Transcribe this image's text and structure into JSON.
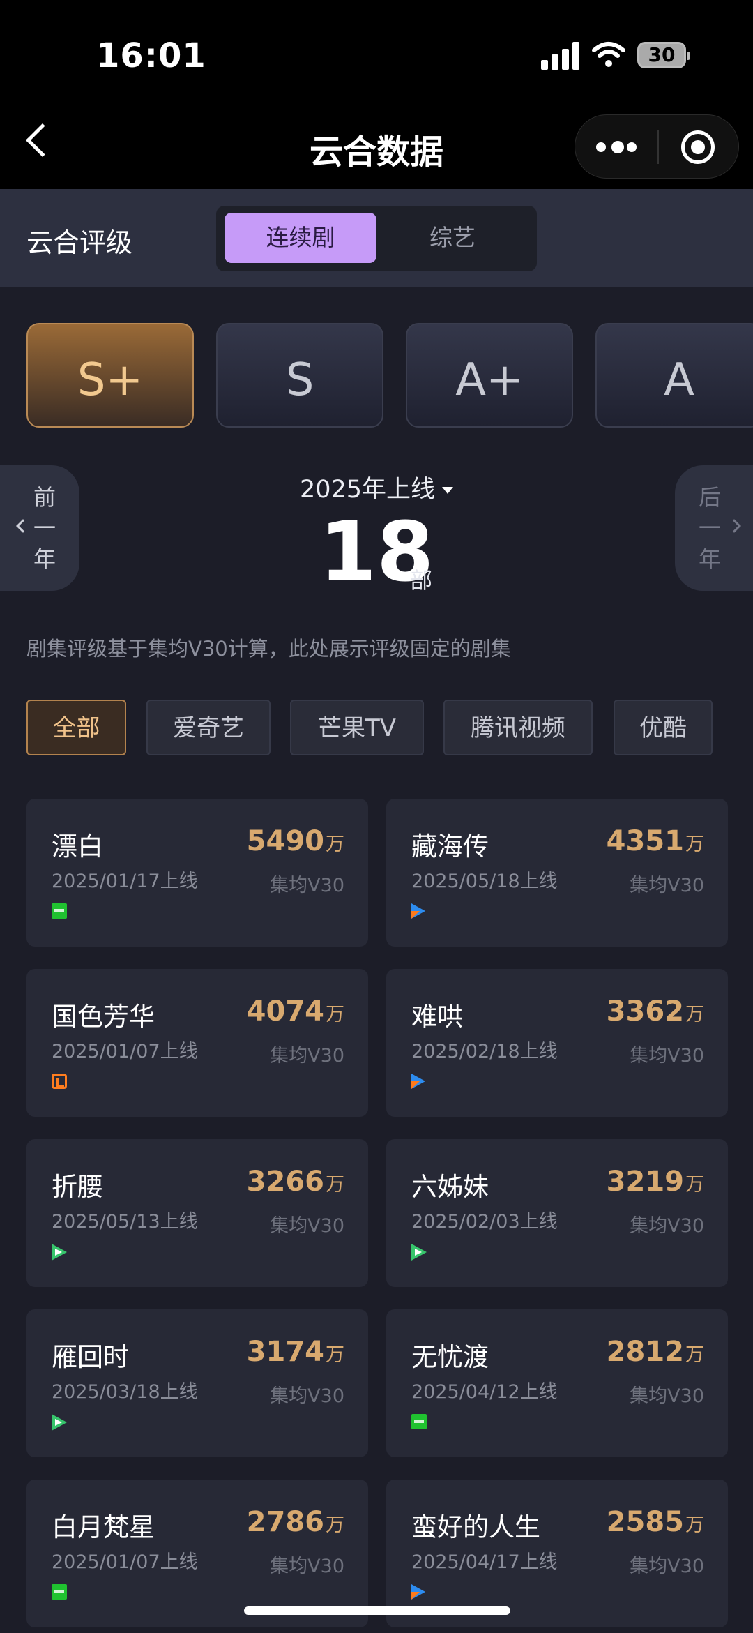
{
  "status_bar": {
    "time": "16:01",
    "battery": "30"
  },
  "nav": {
    "title": "云合数据"
  },
  "header": {
    "title": "云合评级",
    "segments": [
      {
        "label": "连续剧",
        "selected": true
      },
      {
        "label": "综艺",
        "selected": false
      }
    ]
  },
  "grades": [
    {
      "label": "S+",
      "selected": true
    },
    {
      "label": "S",
      "selected": false
    },
    {
      "label": "A+",
      "selected": false
    },
    {
      "label": "A",
      "selected": false
    }
  ],
  "year_nav": {
    "prev": [
      "前",
      "一",
      "年"
    ],
    "next": [
      "后",
      "一",
      "年"
    ],
    "selected_year": "2025年上线",
    "count": "18",
    "count_unit": "部"
  },
  "note": "剧集评级基于集均V30计算，此处展示评级固定的剧集",
  "filters": [
    {
      "label": "全部",
      "selected": true
    },
    {
      "label": "爱奇艺",
      "selected": false
    },
    {
      "label": "芒果TV",
      "selected": false
    },
    {
      "label": "腾讯视频",
      "selected": false
    },
    {
      "label": "优酷",
      "selected": false
    }
  ],
  "value_unit": "万",
  "metric_label": "集均V30",
  "shows": [
    {
      "name": "漂白",
      "date": "2025/01/17上线",
      "platform_icon": "iqiyi-icon",
      "value": "5490"
    },
    {
      "name": "藏海传",
      "date": "2025/05/18上线",
      "platform_icon": "youku-icon",
      "value": "4351"
    },
    {
      "name": "国色芳华",
      "date": "2025/01/07上线",
      "platform_icon": "mango-tv-icon",
      "value": "4074"
    },
    {
      "name": "难哄",
      "date": "2025/02/18上线",
      "platform_icon": "youku-icon",
      "value": "3362"
    },
    {
      "name": "折腰",
      "date": "2025/05/13上线",
      "platform_icon": "tencent-video-icon",
      "value": "3266"
    },
    {
      "name": "六姊妹",
      "date": "2025/02/03上线",
      "platform_icon": "tencent-video-icon",
      "value": "3219"
    },
    {
      "name": "雁回时",
      "date": "2025/03/18上线",
      "platform_icon": "tencent-video-icon",
      "value": "3174"
    },
    {
      "name": "无忧渡",
      "date": "2025/04/12上线",
      "platform_icon": "iqiyi-icon",
      "value": "2812"
    },
    {
      "name": "白月梵星",
      "date": "2025/01/07上线",
      "platform_icon": "iqiyi-icon",
      "value": "2786"
    },
    {
      "name": "蛮好的人生",
      "date": "2025/04/17上线",
      "platform_icon": "youku-icon",
      "value": "2585"
    }
  ]
}
